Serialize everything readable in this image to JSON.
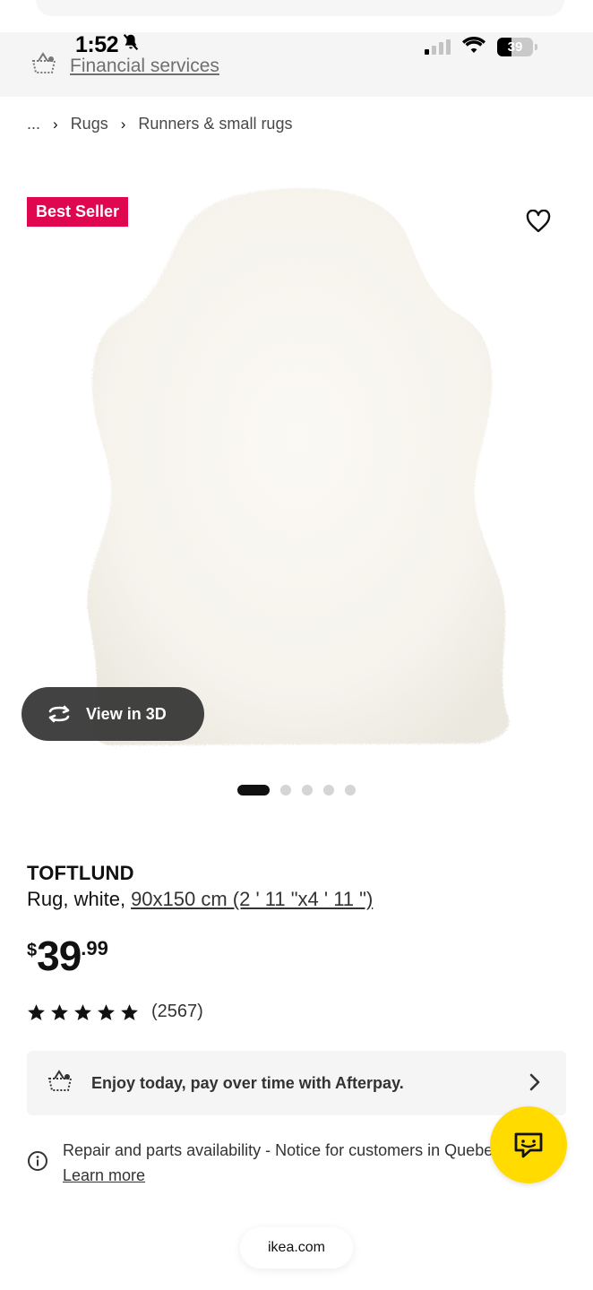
{
  "status_bar": {
    "time": "1:52",
    "battery": "39",
    "battery_level": 0.39
  },
  "header": {
    "financial_services": "Financial services"
  },
  "breadcrumb": {
    "ellipsis": "...",
    "items": [
      "Rugs",
      "Runners & small rugs"
    ]
  },
  "gallery": {
    "badge": "Best Seller",
    "view_3d": "View in 3D",
    "image_count": 5,
    "active_index": 0
  },
  "product": {
    "name": "TOFTLUND",
    "description": "Rug, white,",
    "size": "90x150 cm (2 ' 11 \"x4 ' 11 \")",
    "price": {
      "currency": "$",
      "integer": "39",
      "decimal": ".99"
    },
    "rating": {
      "stars": 5,
      "count": "(2567)"
    }
  },
  "afterpay": {
    "text": "Enjoy today, pay over time with Afterpay."
  },
  "notice": {
    "text": "Repair and parts availability - Notice for customers in Quebec",
    "link": "Learn more"
  },
  "browser": {
    "url": "ikea.com"
  },
  "colors": {
    "badge": "#e00751",
    "chat_button": "#ffdb00",
    "dark_pill": "#323232"
  }
}
